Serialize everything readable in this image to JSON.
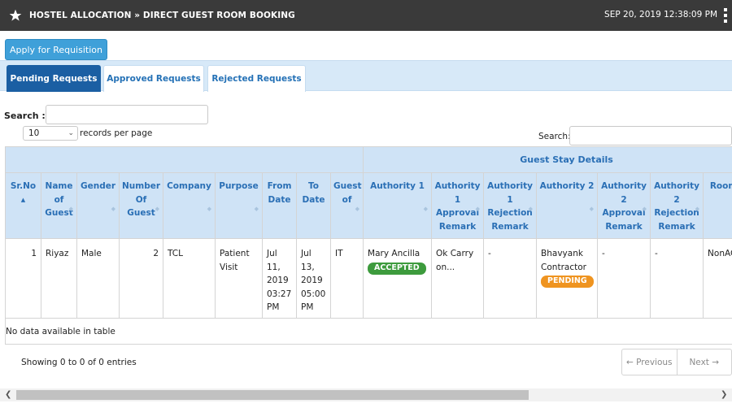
{
  "header": {
    "title": "HOSTEL ALLOCATION » DIRECT GUEST ROOM BOOKING",
    "datetime": "SEP 20, 2019  12:38:09 PM"
  },
  "toolbar": {
    "requisition_label": "Apply for Requisition"
  },
  "tabs": [
    {
      "label": "Pending Requests",
      "active": true
    },
    {
      "label": "Approved Requests",
      "active": false
    },
    {
      "label": "Rejected Requests",
      "active": false
    }
  ],
  "search": {
    "label": "Search :"
  },
  "length": {
    "value": "10",
    "label": "records per page"
  },
  "table_search": {
    "label": "Search:"
  },
  "table": {
    "group_header": "Guest Stay Details",
    "columns": [
      "Sr.No",
      "Name of Guest",
      "Gender",
      "Number Of Guest",
      "Company",
      "Purpose",
      "From Date",
      "To Date",
      "Guest of",
      "Authority 1",
      "Authority 1 Approval Remark",
      "Authority 1 Rejection Remark",
      "Authority 2",
      "Authority 2 Approval Remark",
      "Authority 2 Rejection Remark",
      "Room Desc"
    ],
    "row": {
      "sr_no": "1",
      "name": "Riyaz",
      "gender": "Male",
      "number": "2",
      "company": "TCL",
      "purpose": "Patient Visit",
      "from_date": "Jul 11, 2019 03:27 PM",
      "to_date": "Jul 13, 2019 05:00 PM",
      "guest_of": "IT",
      "authority1": "Mary Ancilla",
      "authority1_status": "ACCEPTED",
      "authority1_approval": "Ok Carry on...",
      "authority1_rejection": "-",
      "authority2": "Bhavyank Contractor",
      "authority2_status": "PENDING",
      "authority2_approval": "-",
      "authority2_rejection": "-",
      "room_desc": "NonAC"
    },
    "empty_message": "No data available in table"
  },
  "footer": {
    "info": "Showing 0 to 0 of 0 entries",
    "previous": "← Previous",
    "next": "Next →"
  },
  "colors": {
    "topbar": "#3a3a3a",
    "accent": "#1b5fa3",
    "header_bg": "#cfe3f6",
    "accepted": "#3d9b3d",
    "pending": "#ef9420"
  }
}
